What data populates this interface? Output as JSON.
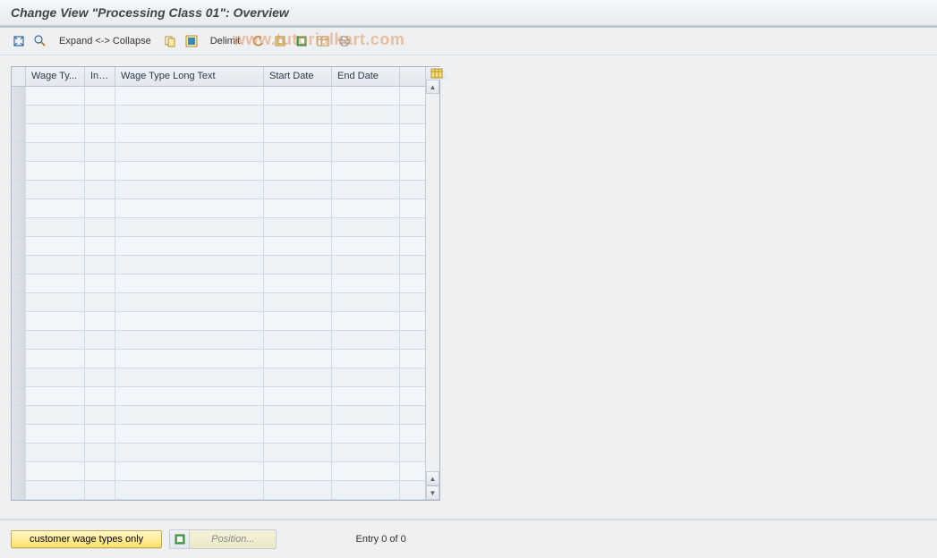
{
  "title": "Change View \"Processing Class 01\": Overview",
  "toolbar": {
    "expand_collapse_label": "Expand <-> Collapse",
    "delimit_label": "Delimit"
  },
  "columns": {
    "col1": "Wage Ty...",
    "col2": "Inf...",
    "col3": "Wage Type Long Text",
    "col4": "Start Date",
    "col5": "End Date"
  },
  "footer": {
    "customer_btn": "customer wage types only",
    "position_label": "Position...",
    "entry_text": "Entry 0 of 0"
  },
  "watermark": "www.tutorialkart.com"
}
